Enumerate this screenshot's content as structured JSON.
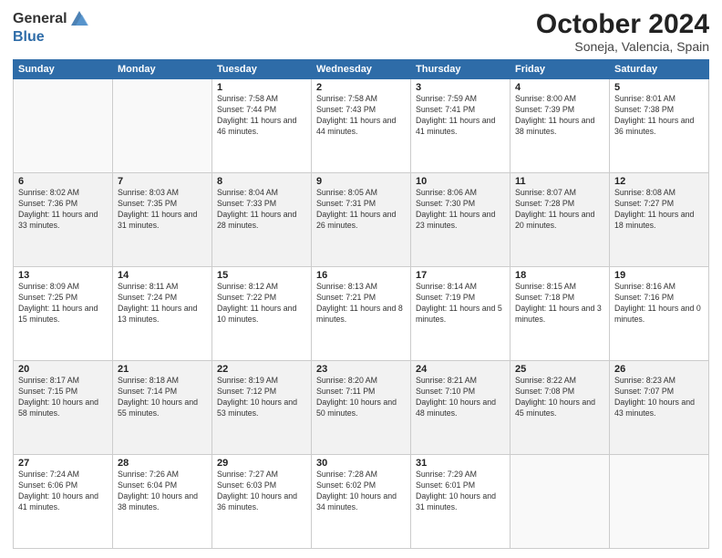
{
  "logo": {
    "line1": "General",
    "line2": "Blue"
  },
  "header": {
    "title": "October 2024",
    "subtitle": "Soneja, Valencia, Spain"
  },
  "weekdays": [
    "Sunday",
    "Monday",
    "Tuesday",
    "Wednesday",
    "Thursday",
    "Friday",
    "Saturday"
  ],
  "weeks": [
    [
      {
        "day": "",
        "info": ""
      },
      {
        "day": "",
        "info": ""
      },
      {
        "day": "1",
        "info": "Sunrise: 7:58 AM\nSunset: 7:44 PM\nDaylight: 11 hours and 46 minutes."
      },
      {
        "day": "2",
        "info": "Sunrise: 7:58 AM\nSunset: 7:43 PM\nDaylight: 11 hours and 44 minutes."
      },
      {
        "day": "3",
        "info": "Sunrise: 7:59 AM\nSunset: 7:41 PM\nDaylight: 11 hours and 41 minutes."
      },
      {
        "day": "4",
        "info": "Sunrise: 8:00 AM\nSunset: 7:39 PM\nDaylight: 11 hours and 38 minutes."
      },
      {
        "day": "5",
        "info": "Sunrise: 8:01 AM\nSunset: 7:38 PM\nDaylight: 11 hours and 36 minutes."
      }
    ],
    [
      {
        "day": "6",
        "info": "Sunrise: 8:02 AM\nSunset: 7:36 PM\nDaylight: 11 hours and 33 minutes."
      },
      {
        "day": "7",
        "info": "Sunrise: 8:03 AM\nSunset: 7:35 PM\nDaylight: 11 hours and 31 minutes."
      },
      {
        "day": "8",
        "info": "Sunrise: 8:04 AM\nSunset: 7:33 PM\nDaylight: 11 hours and 28 minutes."
      },
      {
        "day": "9",
        "info": "Sunrise: 8:05 AM\nSunset: 7:31 PM\nDaylight: 11 hours and 26 minutes."
      },
      {
        "day": "10",
        "info": "Sunrise: 8:06 AM\nSunset: 7:30 PM\nDaylight: 11 hours and 23 minutes."
      },
      {
        "day": "11",
        "info": "Sunrise: 8:07 AM\nSunset: 7:28 PM\nDaylight: 11 hours and 20 minutes."
      },
      {
        "day": "12",
        "info": "Sunrise: 8:08 AM\nSunset: 7:27 PM\nDaylight: 11 hours and 18 minutes."
      }
    ],
    [
      {
        "day": "13",
        "info": "Sunrise: 8:09 AM\nSunset: 7:25 PM\nDaylight: 11 hours and 15 minutes."
      },
      {
        "day": "14",
        "info": "Sunrise: 8:11 AM\nSunset: 7:24 PM\nDaylight: 11 hours and 13 minutes."
      },
      {
        "day": "15",
        "info": "Sunrise: 8:12 AM\nSunset: 7:22 PM\nDaylight: 11 hours and 10 minutes."
      },
      {
        "day": "16",
        "info": "Sunrise: 8:13 AM\nSunset: 7:21 PM\nDaylight: 11 hours and 8 minutes."
      },
      {
        "day": "17",
        "info": "Sunrise: 8:14 AM\nSunset: 7:19 PM\nDaylight: 11 hours and 5 minutes."
      },
      {
        "day": "18",
        "info": "Sunrise: 8:15 AM\nSunset: 7:18 PM\nDaylight: 11 hours and 3 minutes."
      },
      {
        "day": "19",
        "info": "Sunrise: 8:16 AM\nSunset: 7:16 PM\nDaylight: 11 hours and 0 minutes."
      }
    ],
    [
      {
        "day": "20",
        "info": "Sunrise: 8:17 AM\nSunset: 7:15 PM\nDaylight: 10 hours and 58 minutes."
      },
      {
        "day": "21",
        "info": "Sunrise: 8:18 AM\nSunset: 7:14 PM\nDaylight: 10 hours and 55 minutes."
      },
      {
        "day": "22",
        "info": "Sunrise: 8:19 AM\nSunset: 7:12 PM\nDaylight: 10 hours and 53 minutes."
      },
      {
        "day": "23",
        "info": "Sunrise: 8:20 AM\nSunset: 7:11 PM\nDaylight: 10 hours and 50 minutes."
      },
      {
        "day": "24",
        "info": "Sunrise: 8:21 AM\nSunset: 7:10 PM\nDaylight: 10 hours and 48 minutes."
      },
      {
        "day": "25",
        "info": "Sunrise: 8:22 AM\nSunset: 7:08 PM\nDaylight: 10 hours and 45 minutes."
      },
      {
        "day": "26",
        "info": "Sunrise: 8:23 AM\nSunset: 7:07 PM\nDaylight: 10 hours and 43 minutes."
      }
    ],
    [
      {
        "day": "27",
        "info": "Sunrise: 7:24 AM\nSunset: 6:06 PM\nDaylight: 10 hours and 41 minutes."
      },
      {
        "day": "28",
        "info": "Sunrise: 7:26 AM\nSunset: 6:04 PM\nDaylight: 10 hours and 38 minutes."
      },
      {
        "day": "29",
        "info": "Sunrise: 7:27 AM\nSunset: 6:03 PM\nDaylight: 10 hours and 36 minutes."
      },
      {
        "day": "30",
        "info": "Sunrise: 7:28 AM\nSunset: 6:02 PM\nDaylight: 10 hours and 34 minutes."
      },
      {
        "day": "31",
        "info": "Sunrise: 7:29 AM\nSunset: 6:01 PM\nDaylight: 10 hours and 31 minutes."
      },
      {
        "day": "",
        "info": ""
      },
      {
        "day": "",
        "info": ""
      }
    ]
  ]
}
